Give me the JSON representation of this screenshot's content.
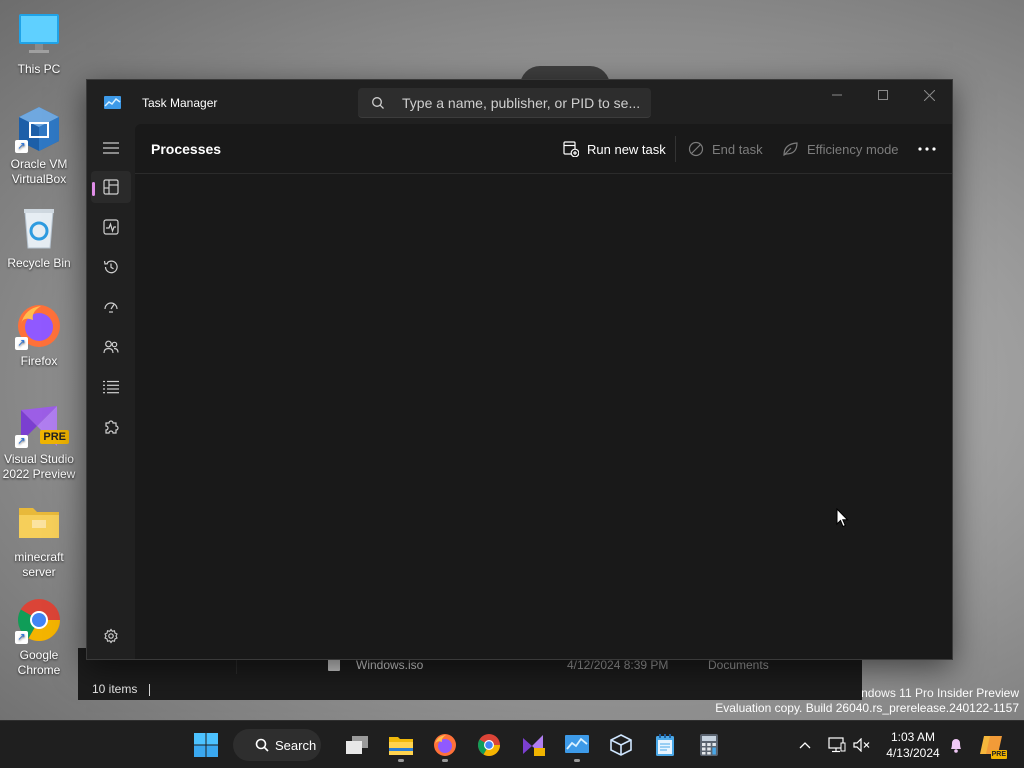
{
  "desktop": {
    "icons": [
      {
        "label": "This PC",
        "icon": "monitor-icon"
      },
      {
        "label": "Oracle VM\nVirtualBox",
        "icon": "virtualbox-icon"
      },
      {
        "label": "Recycle Bin",
        "icon": "recycle-bin-icon"
      },
      {
        "label": "Firefox",
        "icon": "firefox-icon"
      },
      {
        "label": "Visual Studio\n2022 Preview",
        "icon": "visual-studio-icon",
        "badge": "PRE"
      },
      {
        "label": "minecraft\nserver",
        "icon": "folder-icon"
      },
      {
        "label": "Google\nChrome",
        "icon": "chrome-icon"
      }
    ],
    "watermark": {
      "line1": "indows 11 Pro Insider Preview",
      "line2": "Evaluation copy. Build 26040.rs_prerelease.240122-1157"
    }
  },
  "explorer": {
    "row": {
      "name": "Windows.iso",
      "date": "4/12/2024 8:39 PM",
      "location": "Documents"
    },
    "status": "10 items"
  },
  "task_manager": {
    "title": "Task Manager",
    "search_placeholder": "Type a name, publisher, or PID to se...",
    "page_title": "Processes",
    "commands": {
      "run_new_task": "Run new task",
      "end_task": "End task",
      "efficiency_mode": "Efficiency mode"
    },
    "nav": [
      "processes",
      "performance",
      "app-history",
      "startup-apps",
      "users",
      "details",
      "services",
      "settings"
    ],
    "accent": "#e08ee8"
  },
  "taskbar": {
    "search_label": "Search",
    "time": "1:03 AM",
    "date": "4/13/2024",
    "copilot_badge": "PRE"
  }
}
